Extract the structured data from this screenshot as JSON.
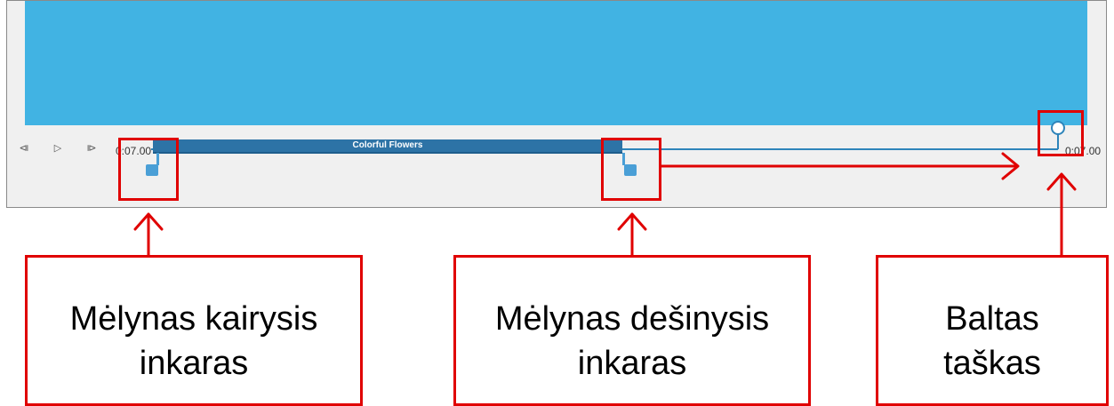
{
  "player": {
    "controls": {
      "prev_icon": "⧏",
      "play_icon": "▷",
      "next_icon": "⧐"
    },
    "start_time": "0:07.00",
    "end_time": "0:07.00",
    "clip_title": "Colorful Flowers"
  },
  "callouts": {
    "left_anchor": [
      "Mėlynas kairysis",
      "inkaras"
    ],
    "right_anchor": [
      "Mėlynas dešinysis",
      "inkaras"
    ],
    "white_dot": [
      "Baltas",
      "taškas"
    ]
  },
  "colors": {
    "preview": "#41b3e3",
    "track": "#2e84ba",
    "clip": "#2d73a6",
    "anchor": "#4a9fd6",
    "highlight": "#e00000"
  }
}
